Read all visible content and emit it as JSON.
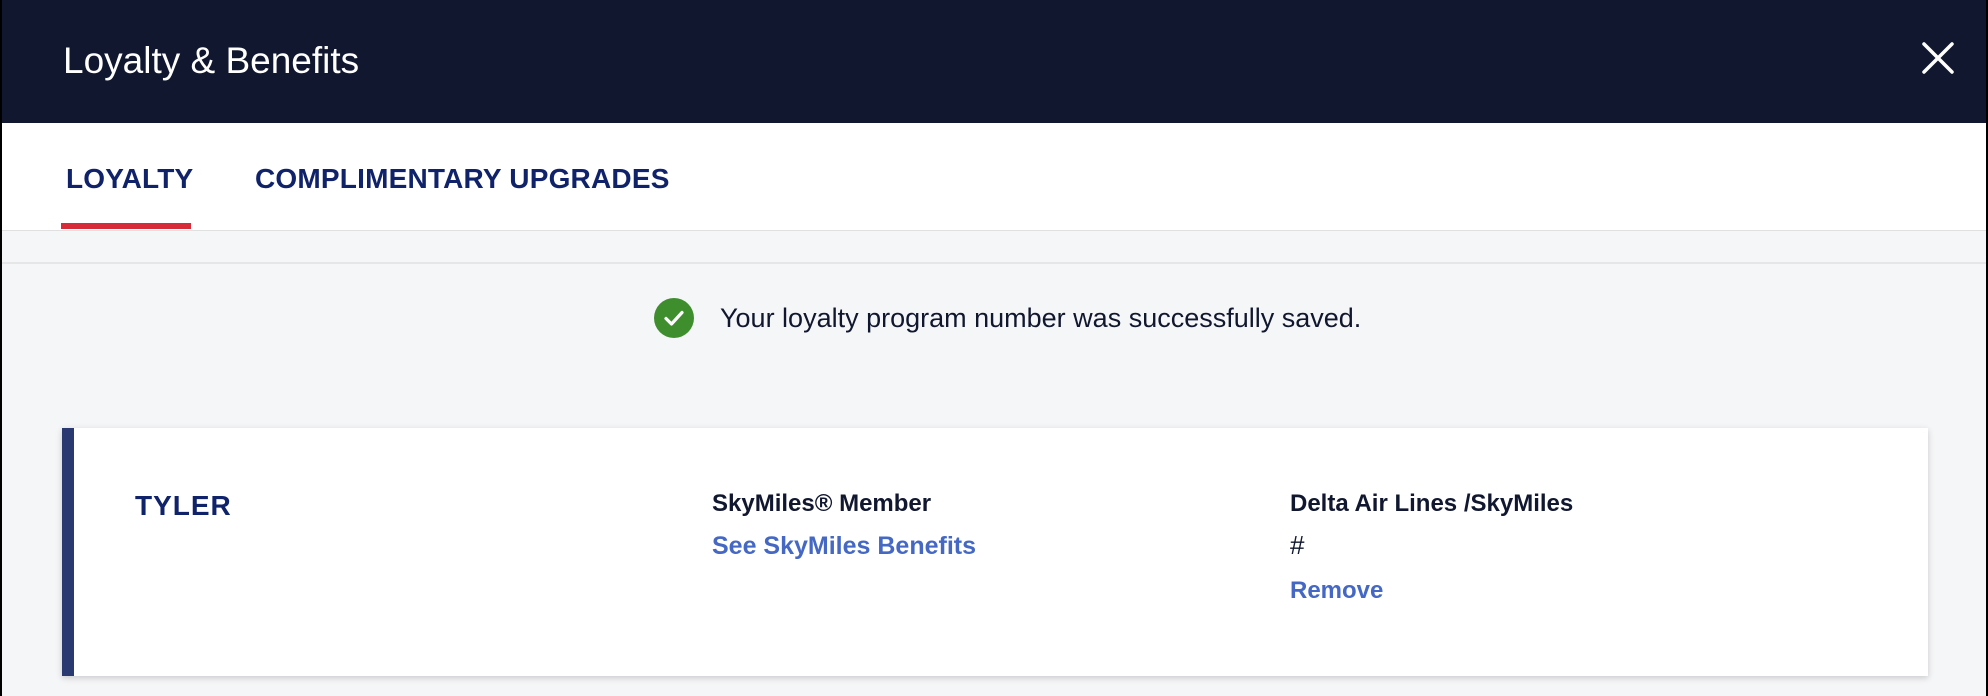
{
  "header": {
    "title": "Loyalty & Benefits"
  },
  "tabs": [
    {
      "label": "LOYALTY",
      "active": true
    },
    {
      "label": "COMPLIMENTARY UPGRADES",
      "active": false
    }
  ],
  "alert": {
    "message": "Your loyalty program number was successfully saved.",
    "icon": "check-circle-icon",
    "color": "#3f8e2e"
  },
  "card": {
    "member_name": "TYLER",
    "status": "SkyMiles® Member",
    "benefits_link": "See SkyMiles Benefits",
    "program_name": "Delta Air Lines /SkyMiles",
    "program_number": "#",
    "remove_label": "Remove"
  },
  "colors": {
    "header_bg": "#10172f",
    "tab_active_underline": "#d82b3a",
    "link": "#4468c4",
    "card_accent": "#2a3a70"
  }
}
